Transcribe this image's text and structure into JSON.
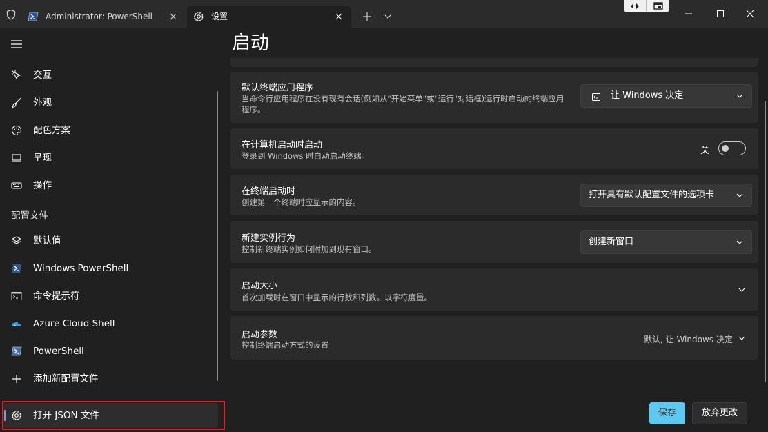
{
  "titlebar": {
    "tabs": [
      {
        "label": "Administrator: PowerShell"
      },
      {
        "label": "设置"
      }
    ]
  },
  "page_title": "启动",
  "sidebar": {
    "items_top": [
      {
        "label": "交互",
        "icon": "interaction-icon"
      },
      {
        "label": "外观",
        "icon": "brush-icon"
      },
      {
        "label": "配色方案",
        "icon": "palette-icon"
      },
      {
        "label": "呈现",
        "icon": "monitor-icon"
      },
      {
        "label": "操作",
        "icon": "keyboard-icon"
      }
    ],
    "profiles_header": "配置文件",
    "profiles": [
      {
        "label": "默认值",
        "icon": "layers-icon"
      },
      {
        "label": "Windows PowerShell",
        "icon": "powershell-icon"
      },
      {
        "label": "命令提示符",
        "icon": "cmd-icon"
      },
      {
        "label": "Azure Cloud Shell",
        "icon": "azure-icon"
      },
      {
        "label": "PowerShell",
        "icon": "powershell-icon"
      }
    ],
    "add_profile": "添加新配置文件",
    "open_json": "打开 JSON 文件"
  },
  "settings": {
    "default_terminal": {
      "title": "默认终端应用程序",
      "desc": "当命令行应用程序在没有现有会话(例如从\"开始菜单\"或\"运行\"对话框)运行时启动的终端应用程序。",
      "value": "让 Windows 决定"
    },
    "launch_on_startup": {
      "title": "在计算机启动时启动",
      "desc": "登录到 Windows 时自动启动终端。",
      "toggle_label": "关",
      "on": false
    },
    "on_launch": {
      "title": "在终端启动时",
      "desc": "创建第一个终端时应显示的内容。",
      "value": "打开具有默认配置文件的选项卡"
    },
    "new_instance": {
      "title": "新建实例行为",
      "desc": "控制新终端实例如何附加到现有窗口。",
      "value": "创建新窗口"
    },
    "launch_size": {
      "title": "启动大小",
      "desc": "首次加载时在窗口中显示的行数和列数。以字符度量。"
    },
    "launch_params": {
      "title": "启动参数",
      "desc": "控制终端启动方式的设置",
      "value": "默认, 让 Windows 决定"
    }
  },
  "footer": {
    "save": "保存",
    "discard": "放弃更改"
  },
  "colors": {
    "accent": "#5fc8f0",
    "highlight_box": "#e0202a"
  }
}
